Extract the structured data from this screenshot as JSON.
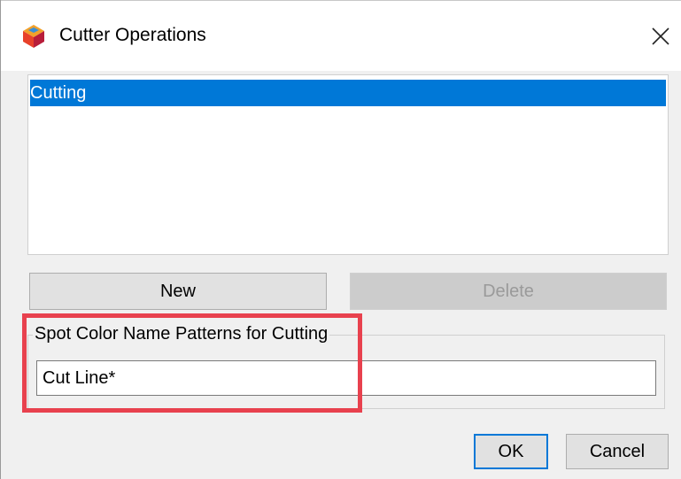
{
  "window": {
    "title": "Cutter Operations",
    "app_icon": "app-icon",
    "close_icon": "close-icon"
  },
  "operations_list": {
    "items": [
      {
        "label": "Cutting",
        "selected": true
      }
    ]
  },
  "buttons": {
    "new_label": "New",
    "delete_label": "Delete",
    "delete_enabled": false,
    "ok_label": "OK",
    "cancel_label": "Cancel"
  },
  "spot_color_group": {
    "label": "Spot Color Name Patterns for Cutting",
    "pattern_value": "Cut Line*"
  },
  "colors": {
    "selection": "#0078d7",
    "highlight_annotation": "#e8414e"
  }
}
